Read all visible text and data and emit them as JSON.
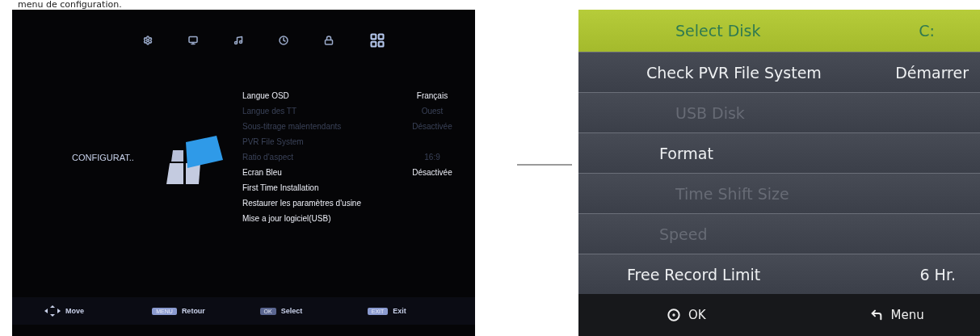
{
  "heading": "menu de configuration.",
  "tv_menu": {
    "top_icons": [
      {
        "selected": false
      },
      {
        "selected": false
      },
      {
        "selected": false
      },
      {
        "selected": false
      },
      {
        "selected": false
      },
      {
        "selected": true
      }
    ],
    "section_title": "CONFIGURAT..",
    "items": [
      {
        "label": "Langue OSD",
        "value": "Français",
        "disabled": false
      },
      {
        "label": "Langue des TT",
        "value": "Ouest",
        "disabled": true
      },
      {
        "label": "Sous-titrage malentendants",
        "value": "Désactivée",
        "disabled": true
      },
      {
        "label": "PVR File System",
        "disabled": true
      },
      {
        "label": "Ratio d'aspect",
        "value": "16:9",
        "disabled": true
      },
      {
        "label": "Ecran Bleu",
        "value": "Désactivée",
        "disabled": false
      },
      {
        "label": "First Time Installation",
        "disabled": false
      },
      {
        "label": "Restaurer les paramètres d'usine",
        "disabled": false
      },
      {
        "label": "Mise a jour logiciel(USB)",
        "disabled": false
      }
    ],
    "hints": [
      {
        "kind": "arrows",
        "label": "Move"
      },
      {
        "kind": "key",
        "key": "MENU",
        "label": "Retour"
      },
      {
        "kind": "key",
        "key": "OK",
        "label": "Select"
      },
      {
        "kind": "key",
        "key": "EXIT",
        "label": "Exit"
      }
    ]
  },
  "pvr_menu": {
    "rows": [
      {
        "label": "Select Disk",
        "value": "C:",
        "selected": true,
        "disabled": false
      },
      {
        "label": "Check PVR File System",
        "value": "Démarrer",
        "selected": false,
        "disabled": false
      },
      {
        "label": "USB Disk",
        "selected": false,
        "disabled": true
      },
      {
        "label": "Format",
        "selected": false,
        "disabled": false
      },
      {
        "label": "Time Shift Size",
        "selected": false,
        "disabled": true
      },
      {
        "label": "Speed",
        "selected": false,
        "disabled": true
      },
      {
        "label": "Free Record Limit",
        "value": "6 Hr.",
        "selected": false,
        "disabled": false
      }
    ],
    "footer": [
      {
        "kind": "ok",
        "label": "OK"
      },
      {
        "kind": "menu",
        "label": "Menu"
      }
    ]
  }
}
